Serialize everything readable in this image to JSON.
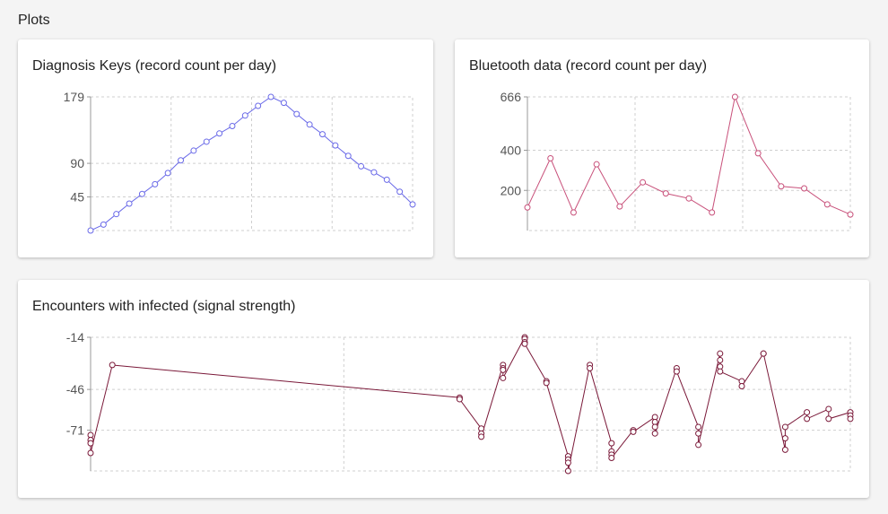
{
  "page": {
    "section_title": "Plots"
  },
  "chart_data": [
    {
      "type": "line",
      "title": "Diagnosis Keys (record count per day)",
      "color": "#6a6ae8",
      "y_ticks": [
        179,
        90,
        45
      ],
      "ylim": [
        0,
        179
      ],
      "x": [
        0,
        1,
        2,
        3,
        4,
        5,
        6,
        7,
        8,
        9,
        10,
        11,
        12,
        13,
        14,
        15,
        16,
        17,
        18,
        19,
        20,
        21,
        22,
        23,
        24,
        25
      ],
      "values": [
        0,
        8,
        22,
        36,
        49,
        62,
        77,
        94,
        107,
        119,
        130,
        140,
        154,
        167,
        179,
        171,
        156,
        142,
        129,
        114,
        100,
        86,
        78,
        68,
        52,
        35
      ]
    },
    {
      "type": "line",
      "title": "Bluetooth data (record count per day)",
      "color": "#c8507a",
      "y_ticks": [
        666,
        400,
        200
      ],
      "ylim": [
        0,
        666
      ],
      "x": [
        0,
        1,
        2,
        3,
        4,
        5,
        6,
        7,
        8,
        9,
        10,
        11,
        12,
        13,
        14
      ],
      "values": [
        115,
        360,
        90,
        330,
        120,
        240,
        185,
        160,
        90,
        666,
        385,
        220,
        210,
        130,
        80
      ]
    },
    {
      "type": "line",
      "title": "Encounters with infected (signal strength)",
      "color": "#7a1838",
      "y_ticks": [
        -14,
        -46,
        -71
      ],
      "ylim": [
        -96,
        -14
      ],
      "x": [
        0,
        0,
        0,
        0,
        1,
        17,
        17,
        18,
        18,
        18,
        19,
        19,
        19,
        19,
        20,
        20,
        20,
        20,
        21,
        21,
        22,
        22,
        22,
        22,
        23,
        23,
        24,
        24,
        24,
        24,
        25,
        25,
        26,
        26,
        26,
        26,
        27,
        27,
        28,
        28,
        28,
        29,
        29,
        29,
        29,
        30,
        30,
        31,
        31,
        32,
        32,
        32,
        33,
        33,
        34,
        34,
        35,
        35,
        35
      ],
      "values": [
        -74,
        -77,
        -79,
        -85,
        -31,
        -51,
        -52,
        -70,
        -73,
        -75,
        -31,
        -33,
        -34,
        -39,
        -14,
        -15,
        -17,
        -18,
        -41,
        -42,
        -87,
        -89,
        -91,
        -96,
        -31,
        -33,
        -79,
        -84,
        -86,
        -88,
        -71,
        -72,
        -63,
        -66,
        -69,
        -73,
        -33,
        -35,
        -69,
        -73,
        -80,
        -24,
        -28,
        -32,
        -35,
        -41,
        -44,
        -24,
        -24,
        -83,
        -76,
        -69,
        -60,
        -64,
        -58,
        -64,
        -60,
        -62,
        -64
      ]
    }
  ]
}
